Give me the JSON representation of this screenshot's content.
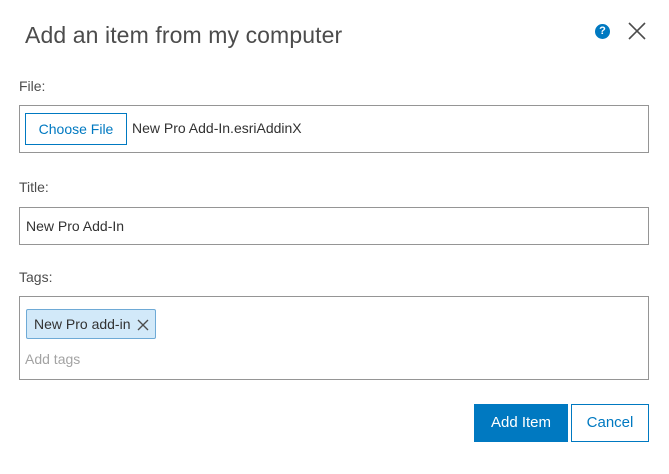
{
  "dialog": {
    "title": "Add an item from my computer",
    "help_icon": "question-circle-icon",
    "close_icon": "close-icon",
    "help_glyph": "?"
  },
  "file": {
    "label": "File:",
    "choose_button_label": "Choose File",
    "file_name": "New Pro Add-In.esriAddinX"
  },
  "title_field": {
    "label": "Title:",
    "value": "New Pro Add-In"
  },
  "tags": {
    "label": "Tags:",
    "chips": [
      "New Pro add-in"
    ],
    "placeholder": "Add tags",
    "remove_icon": "x-icon"
  },
  "footer": {
    "add_item_label": "Add Item",
    "cancel_label": "Cancel"
  },
  "colors": {
    "accent": "#0079c1",
    "chip_background": "#d2e9f9",
    "border": "#959595"
  }
}
